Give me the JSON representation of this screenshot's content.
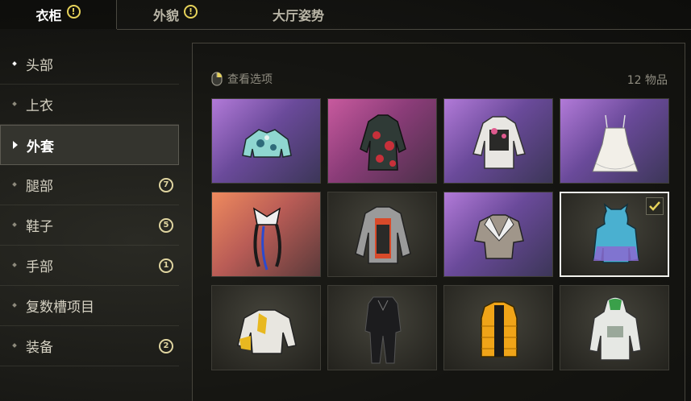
{
  "tabs": [
    {
      "label": "衣柜",
      "alert": "!"
    },
    {
      "label": "外貌",
      "alert": "!"
    },
    {
      "label": "大厅姿势"
    }
  ],
  "sidebar": {
    "items": [
      {
        "label": "头部"
      },
      {
        "label": "上衣"
      },
      {
        "label": "外套"
      },
      {
        "label": "腿部",
        "badge": "7"
      },
      {
        "label": "鞋子",
        "badge": "5"
      },
      {
        "label": "手部",
        "badge": "1"
      },
      {
        "label": "复数槽项目"
      },
      {
        "label": "装备",
        "badge": "2"
      }
    ]
  },
  "panel": {
    "view_options_label": "查看选项",
    "item_count": "12 物品"
  },
  "colors": {
    "accent_yellow": "#e6d25a",
    "selected_border": "#f2f2ec"
  },
  "items": [
    {
      "icon": "cropped-floral-jacket-icon"
    },
    {
      "icon": "red-floral-coat-icon"
    },
    {
      "icon": "white-vest-jacket-icon"
    },
    {
      "icon": "white-dress-top-icon"
    },
    {
      "icon": "ribbon-top-icon"
    },
    {
      "icon": "grey-red-jacket-icon"
    },
    {
      "icon": "sailor-top-icon"
    },
    {
      "icon": "blue-cat-hoodie-icon",
      "selected": true
    },
    {
      "icon": "yellow-white-jacket-icon"
    },
    {
      "icon": "black-suit-icon"
    },
    {
      "icon": "yellow-puffer-vest-icon"
    },
    {
      "icon": "white-green-hoodie-icon"
    }
  ]
}
